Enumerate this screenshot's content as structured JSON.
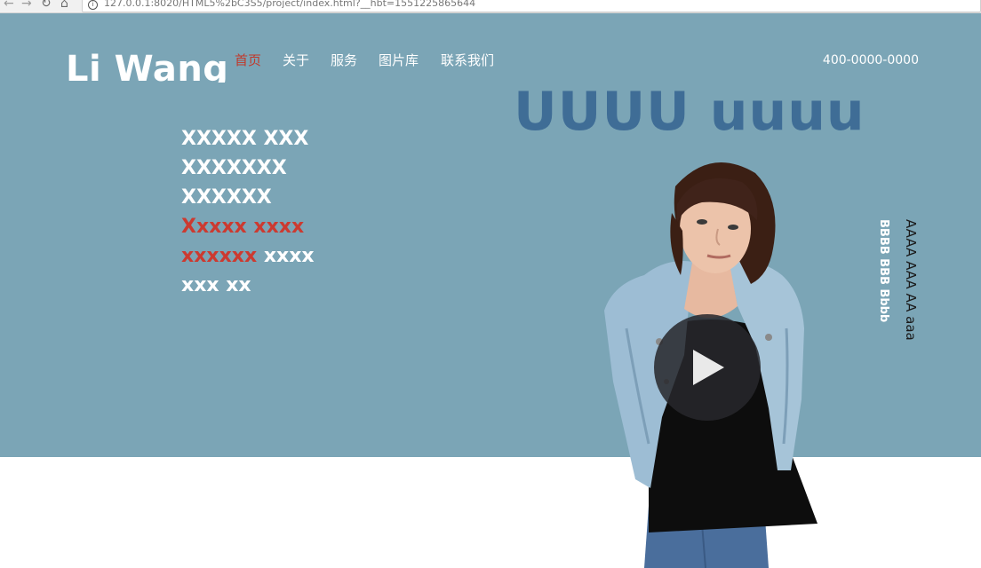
{
  "browser": {
    "url": "127.0.0.1:8020/HTML5%2bC3S5/project/index.html?__hbt=1551225865644"
  },
  "header": {
    "logo": "Li Wang",
    "nav": [
      "首页",
      "关于",
      "服务",
      "图片库",
      "联系我们"
    ],
    "active_nav_index": 0,
    "phone": "400-0000-0000"
  },
  "hero": {
    "headline": "UUUU uuuu",
    "lines": {
      "l1": "XXXXX XXX",
      "l2": "XXXXXXX",
      "l3": "XXXXXX",
      "l4": "Xxxxx xxxx",
      "l5a": "xxxxxx",
      "l5b": " xxxx",
      "l6": "xxx xx"
    },
    "vertical_white": "BBBB BBB Bbbb",
    "vertical_dark": "AAAA AAA AA aaa"
  },
  "colors": {
    "hero_bg": "#7ba5b6",
    "headline": "#3f6d96",
    "accent_red": "#cc3a30"
  },
  "icons": [
    "back-arrow-icon",
    "forward-arrow-icon",
    "reload-icon",
    "home-icon",
    "info-icon",
    "play-icon"
  ]
}
